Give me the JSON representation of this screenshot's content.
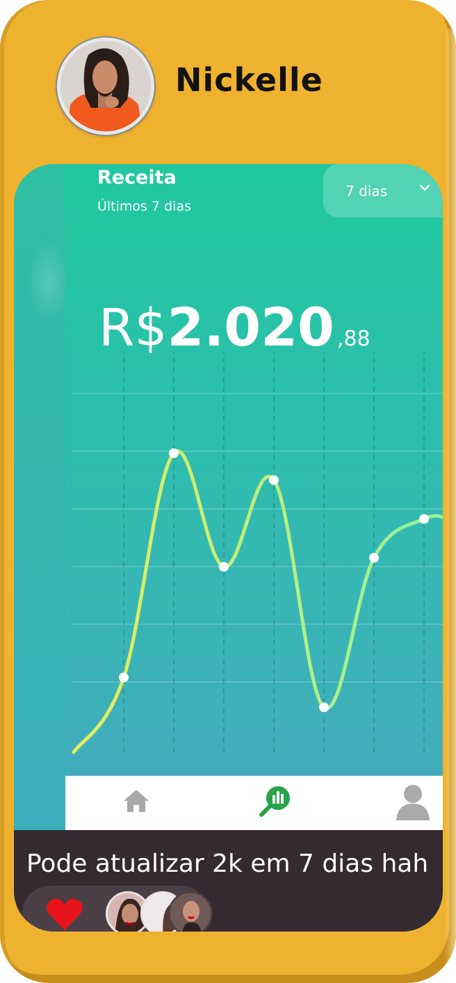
{
  "story": {
    "username": "Nickelle",
    "caption": "Pode atualizar 2k em 7 dias hah"
  },
  "revenue": {
    "title": "Receita",
    "subtitle": "Últimos 7 dias",
    "period_button": "7 dias",
    "currency": "R$",
    "amount_int": "2.020",
    "amount_dec": ",88"
  },
  "chart_data": {
    "type": "line",
    "title": "",
    "xlabel": "",
    "ylabel": "",
    "grid": true,
    "values": [
      12,
      87,
      49,
      78,
      2,
      52,
      65
    ],
    "colors": {
      "start": "#e8ee5a",
      "end": "#8ff0a0"
    }
  },
  "nav": {
    "items": [
      {
        "icon": "home-icon"
      },
      {
        "icon": "analytics-icon",
        "active": true
      },
      {
        "icon": "profile-icon"
      }
    ],
    "colors": {
      "inactive": "#a9a9a9",
      "active": "#27a34a"
    }
  },
  "colors": {
    "frame": "#efb22f",
    "app_top": "#21c89f",
    "app_bottom": "#46a9bd",
    "caption_bg": "#352a2f",
    "heart": "#e8141b"
  }
}
